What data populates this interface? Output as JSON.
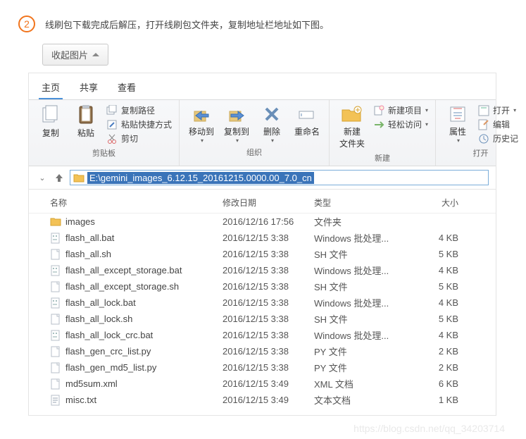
{
  "step": {
    "number": "2",
    "text": "线刷包下载完成后解压，打开线刷包文件夹，复制地址栏地址如下图。"
  },
  "collapse": {
    "label": "收起图片"
  },
  "tabs": {
    "home": "主页",
    "share": "共享",
    "view": "查看"
  },
  "ribbon": {
    "copy": "复制",
    "paste": "粘贴",
    "copy_path": "复制路径",
    "paste_shortcut": "粘贴快捷方式",
    "cut": "剪切",
    "clipboard": "剪贴板",
    "move_to": "移动到",
    "copy_to": "复制到",
    "delete": "删除",
    "rename": "重命名",
    "organize": "组织",
    "new_folder": "新建\n文件夹",
    "new_item": "新建项目",
    "easy_access": "轻松访问",
    "new": "新建",
    "properties": "属性",
    "open": "打开",
    "edit": "编辑",
    "history": "历史记",
    "open_group": "打开"
  },
  "address": {
    "path": "E:\\gemini_images_6.12.15_20161215.0000.00_7.0_cn"
  },
  "columns": {
    "name": "名称",
    "date": "修改日期",
    "type": "类型",
    "size": "大小"
  },
  "files": [
    {
      "icon": "folder",
      "name": "images",
      "date": "2016/12/16 17:56",
      "type": "文件夹",
      "size": ""
    },
    {
      "icon": "bat",
      "name": "flash_all.bat",
      "date": "2016/12/15 3:38",
      "type": "Windows 批处理...",
      "size": "4 KB"
    },
    {
      "icon": "file",
      "name": "flash_all.sh",
      "date": "2016/12/15 3:38",
      "type": "SH 文件",
      "size": "5 KB"
    },
    {
      "icon": "bat",
      "name": "flash_all_except_storage.bat",
      "date": "2016/12/15 3:38",
      "type": "Windows 批处理...",
      "size": "4 KB"
    },
    {
      "icon": "file",
      "name": "flash_all_except_storage.sh",
      "date": "2016/12/15 3:38",
      "type": "SH 文件",
      "size": "5 KB"
    },
    {
      "icon": "bat",
      "name": "flash_all_lock.bat",
      "date": "2016/12/15 3:38",
      "type": "Windows 批处理...",
      "size": "4 KB"
    },
    {
      "icon": "file",
      "name": "flash_all_lock.sh",
      "date": "2016/12/15 3:38",
      "type": "SH 文件",
      "size": "5 KB"
    },
    {
      "icon": "bat",
      "name": "flash_all_lock_crc.bat",
      "date": "2016/12/15 3:38",
      "type": "Windows 批处理...",
      "size": "4 KB"
    },
    {
      "icon": "file",
      "name": "flash_gen_crc_list.py",
      "date": "2016/12/15 3:38",
      "type": "PY 文件",
      "size": "2 KB"
    },
    {
      "icon": "file",
      "name": "flash_gen_md5_list.py",
      "date": "2016/12/15 3:38",
      "type": "PY 文件",
      "size": "2 KB"
    },
    {
      "icon": "file",
      "name": "md5sum.xml",
      "date": "2016/12/15 3:49",
      "type": "XML 文档",
      "size": "6 KB"
    },
    {
      "icon": "txt",
      "name": "misc.txt",
      "date": "2016/12/15 3:49",
      "type": "文本文档",
      "size": "1 KB"
    }
  ],
  "watermark": "https://blog.csdn.net/qq_34203714"
}
